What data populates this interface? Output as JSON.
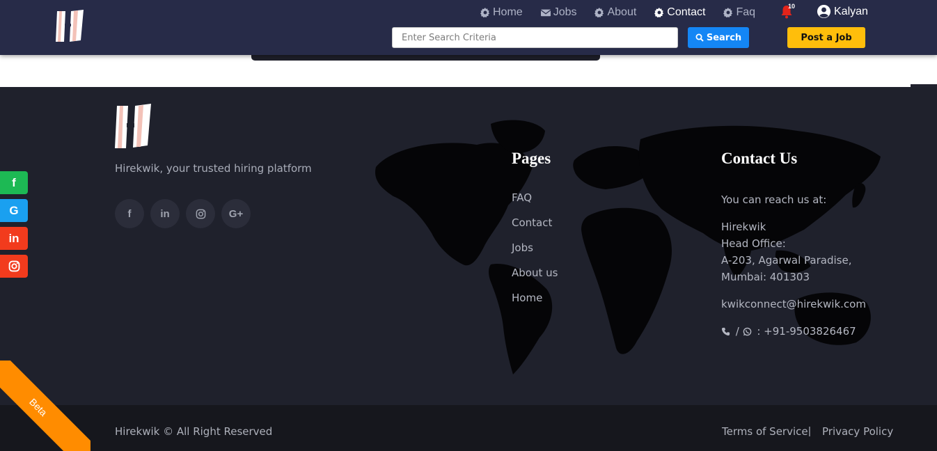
{
  "header": {
    "nav": [
      {
        "label": "Home",
        "icon": "gear-icon",
        "active": false
      },
      {
        "label": "Jobs",
        "icon": "envelope-icon",
        "active": false
      },
      {
        "label": "About",
        "icon": "gear-icon",
        "active": false
      },
      {
        "label": "Contact",
        "icon": "gear-icon",
        "active": true
      },
      {
        "label": "Faq",
        "icon": "gear-icon",
        "active": false
      }
    ],
    "notification_count": "10",
    "user_name": "Kalyan",
    "search_placeholder": "Enter Search Criteria",
    "search_value": "",
    "search_button": "Search",
    "post_job_button": "Post a Job"
  },
  "footer": {
    "tagline": "Hirekwik, your trusted hiring platform",
    "social": [
      {
        "name": "facebook",
        "glyph": "f"
      },
      {
        "name": "linkedin",
        "glyph": "in"
      },
      {
        "name": "instagram",
        "glyph": ""
      },
      {
        "name": "google-plus",
        "glyph": "G+"
      }
    ],
    "pages_title": "Pages",
    "pages": [
      "FAQ",
      "Contact",
      "Jobs",
      "About us",
      "Home"
    ],
    "contact_title": "Contact Us",
    "contact_intro": "You can reach us at:",
    "company": "Hirekwik",
    "office_label": "Head Office:",
    "address_line1": "A-203, Agarwal Paradise,",
    "address_line2": "Mumbai: 401303",
    "email": "kwikconnect@hirekwik.com",
    "phone_sep": " / ",
    "phone": " : +91-9503826467"
  },
  "bottom": {
    "copyright": "Hirekwik © All Right Reserved",
    "terms": "Terms of Service",
    "separator": "|",
    "privacy": "Privacy Policy"
  },
  "share_bar": [
    {
      "name": "facebook",
      "glyph": "f",
      "color": "#1db954"
    },
    {
      "name": "google",
      "glyph": "G",
      "color": "#1aa0f0"
    },
    {
      "name": "linkedin",
      "glyph": "in",
      "color": "#f23b1d"
    },
    {
      "name": "instagram",
      "glyph": "",
      "color": "#f23b1d"
    }
  ],
  "beta_label": "Beta",
  "colors": {
    "header_bg": "#272b48",
    "footer_bg": "#1f212c",
    "bottom_bg": "#16171d",
    "search_blue": "#1486f5",
    "post_yellow": "#ffbe0b",
    "beta_orange": "#ff8c00",
    "bell_red": "#e3241a"
  }
}
